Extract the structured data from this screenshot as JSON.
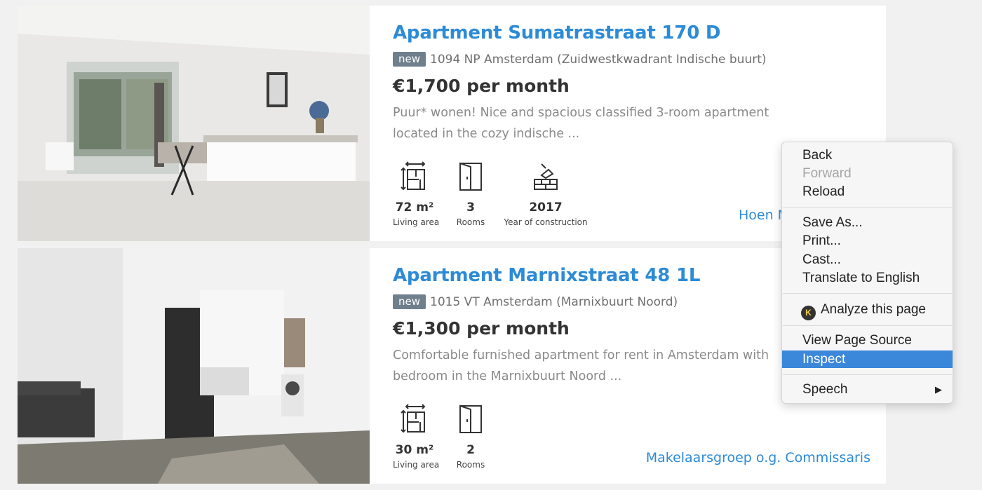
{
  "listings": [
    {
      "title": "Apartment Sumatrastraat 170 D",
      "badge": "new",
      "address": "1094 NP Amsterdam (Zuidwestkwadrant Indische buurt)",
      "price": "€1,700 per month",
      "description": "Puur* wonen! Nice and spacious classified 3-room apartment located in the cozy indische ...",
      "features": [
        {
          "value": "72 m²",
          "label": "Living area",
          "icon": "floor-plan-icon"
        },
        {
          "value": "3",
          "label": "Rooms",
          "icon": "door-icon"
        },
        {
          "value": "2017",
          "label": "Year of construction",
          "icon": "bricks-trowel-icon"
        }
      ],
      "agent": "Hoen M"
    },
    {
      "title": "Apartment Marnixstraat 48 1L",
      "badge": "new",
      "address": "1015 VT Amsterdam (Marnixbuurt Noord)",
      "price": "€1,300 per month",
      "description": "Comfortable furnished apartment for rent in Amsterdam with bedroom in the Marnixbuurt Noord ...",
      "features": [
        {
          "value": "30 m²",
          "label": "Living area",
          "icon": "floor-plan-icon"
        },
        {
          "value": "2",
          "label": "Rooms",
          "icon": "door-icon"
        }
      ],
      "agent": "Makelaarsgroep o.g. Commissaris"
    }
  ],
  "context_menu": {
    "back": "Back",
    "forward": "Forward",
    "reload": "Reload",
    "save_as": "Save As...",
    "print": "Print...",
    "cast": "Cast...",
    "translate": "Translate to English",
    "analyze": "Analyze this page",
    "analyze_icon_letter": "K",
    "view_source": "View Page Source",
    "inspect": "Inspect",
    "speech": "Speech",
    "submenu_arrow": "▶"
  },
  "colors": {
    "link_blue": "#2d8bd6",
    "badge_gray": "#6f7f8c",
    "menu_highlight": "#3b87d9"
  }
}
